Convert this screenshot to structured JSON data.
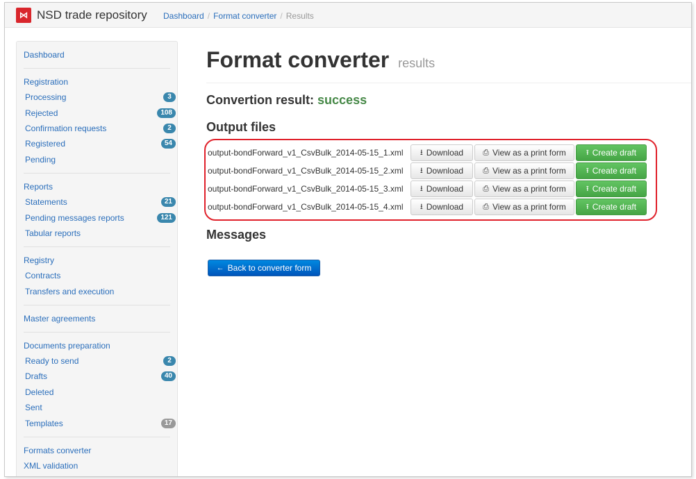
{
  "header": {
    "logo_glyph": "⋈",
    "brand": "NSD trade repository",
    "breadcrumb": [
      "Dashboard",
      "Format converter",
      "Results"
    ]
  },
  "sidebar": {
    "dashboard": "Dashboard",
    "registration": {
      "label": "Registration",
      "items": [
        {
          "label": "Processing",
          "badge": "3"
        },
        {
          "label": "Rejected",
          "badge": "108"
        },
        {
          "label": "Confirmation requests",
          "badge": "2"
        },
        {
          "label": "Registered",
          "badge": "54"
        },
        {
          "label": "Pending",
          "badge": ""
        }
      ]
    },
    "reports": {
      "label": "Reports",
      "items": [
        {
          "label": "Statements",
          "badge": "21"
        },
        {
          "label": "Pending messages reports",
          "badge": "121"
        },
        {
          "label": "Tabular reports",
          "badge": ""
        }
      ]
    },
    "registry": {
      "label": "Registry",
      "items": [
        {
          "label": "Contracts"
        },
        {
          "label": "Transfers and execution"
        }
      ]
    },
    "master_agreements": "Master agreements",
    "documents": {
      "label": "Documents preparation",
      "items": [
        {
          "label": "Ready to send",
          "badge": "2"
        },
        {
          "label": "Drafts",
          "badge": "40"
        },
        {
          "label": "Deleted",
          "badge": ""
        },
        {
          "label": "Sent",
          "badge": ""
        },
        {
          "label": "Templates",
          "badge": "17"
        }
      ]
    },
    "formats_converter": "Formats converter",
    "xml_validation": "XML validation"
  },
  "main": {
    "title": "Format converter",
    "title_small": "results",
    "result_label": "Convertion result:",
    "result_value": "success",
    "output_heading": "Output files",
    "files": [
      "output-bondForward_v1_CsvBulk_2014-05-15_1.xml",
      "output-bondForward_v1_CsvBulk_2014-05-15_2.xml",
      "output-bondForward_v1_CsvBulk_2014-05-15_3.xml",
      "output-bondForward_v1_CsvBulk_2014-05-15_4.xml"
    ],
    "buttons": {
      "download": "Download",
      "print_form": "View as a print form",
      "create_draft": "Create draft"
    },
    "messages_heading": "Messages",
    "back_button": "Back to converter form"
  },
  "colors": {
    "link": "#2a6ebb",
    "success": "#468847",
    "green_button": "#46a546",
    "blue_button": "#0066cc",
    "highlight": "#e0202a"
  }
}
